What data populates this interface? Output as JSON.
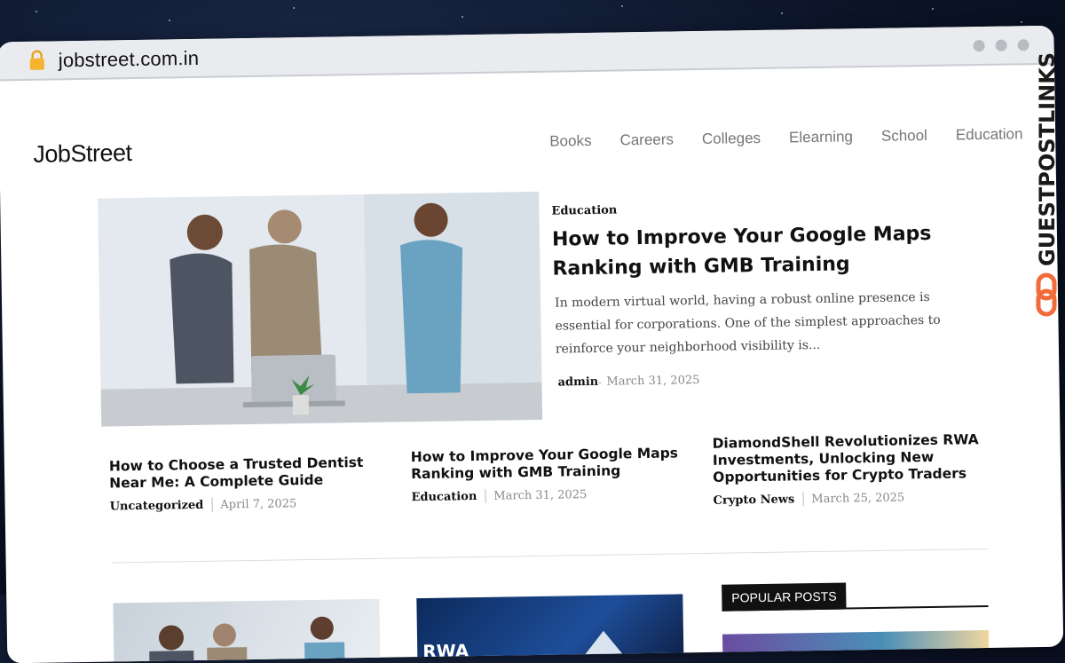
{
  "browser": {
    "url": "jobstreet.com.in"
  },
  "site": {
    "logo": "JobStreet",
    "nav": [
      "Books",
      "Careers",
      "Colleges",
      "Elearning",
      "School",
      "Education"
    ]
  },
  "hero": {
    "category": "Education",
    "title": "How to Improve Your Google Maps Ranking with GMB Training",
    "excerpt": "In modern virtual world, having a robust online presence is essential for corporations. One of the simplest approaches to reinforce your neighborhood visibility is...",
    "author": "admin",
    "separator": "-",
    "date": "March 31, 2025"
  },
  "cards": [
    {
      "title": "How to Choose a Trusted Dentist Near Me: A Complete Guide",
      "category": "Uncategorized",
      "date": "April 7, 2025"
    },
    {
      "title": "How to Improve Your Google Maps Ranking with GMB Training",
      "category": "Education",
      "date": "March 31, 2025"
    },
    {
      "title": "DiamondShell Revolutionizes RWA Investments, Unlocking New Opportunities for Crypto Traders",
      "category": "Crypto News",
      "date": "March 25, 2025"
    }
  ],
  "thumb2_text": "RWA",
  "sidebar": {
    "popular_label": "POPULAR POSTS"
  },
  "watermark": {
    "text": "GUESTPOSTLINKS"
  },
  "colors": {
    "accent": "#f26b3a",
    "lock": "#f5b430"
  }
}
